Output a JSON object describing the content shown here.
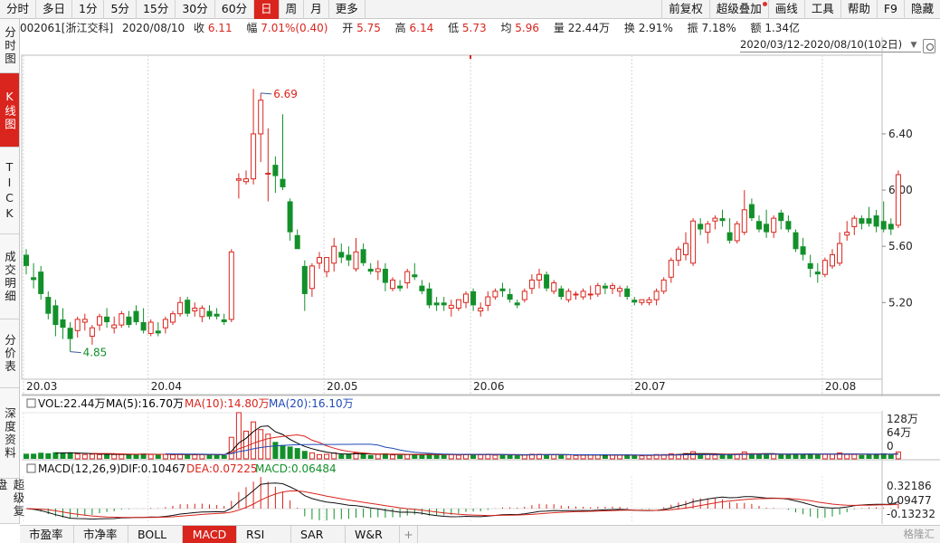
{
  "toolbar": {
    "periods": [
      "分时",
      "多日",
      "1分",
      "5分",
      "15分",
      "30分",
      "60分",
      "日",
      "周",
      "月",
      "更多"
    ],
    "active_period": "日",
    "right_buttons": [
      "前复权",
      "超级叠加",
      "画线",
      "工具",
      "帮助",
      "F9",
      "隐藏"
    ]
  },
  "info": {
    "code_name": "002061[浙江交科]",
    "date": "2020/08/10",
    "close_label": "收",
    "close": "6.11",
    "change_label": "幅",
    "change": "7.01%(0.40)",
    "open_label": "开",
    "open": "5.75",
    "high_label": "高",
    "high": "6.14",
    "low_label": "低",
    "low": "5.73",
    "avg_label": "均",
    "avg": "5.96",
    "volume_label": "量",
    "volume": "22.44万",
    "turnover_label": "换",
    "turnover": "2.91%",
    "amplitude_label": "振",
    "amplitude": "7.18%",
    "amount_label": "额",
    "amount": "1.34亿"
  },
  "side_tabs": [
    "分时图",
    "K线图",
    "TICK",
    "成交明细",
    "分价表",
    "深度资料",
    "超级复盘"
  ],
  "date_range": "2020/03/12-2020/08/10(102日)",
  "colors": {
    "up": "#d9251d",
    "down": "#12902a",
    "accent": "#d9251d",
    "ma5": "#000000",
    "ma10": "#d9251d",
    "ma20": "#1f49b8"
  },
  "chart_data": {
    "type": "candlestick",
    "price_axis": {
      "ticks": [
        "6.40",
        "6.00",
        "5.60",
        "5.20"
      ],
      "ylim": [
        4.68,
        6.96
      ]
    },
    "date_ticks": [
      {
        "label": "20.03",
        "index": 0
      },
      {
        "label": "20.04",
        "index": 17
      },
      {
        "label": "20.05",
        "index": 41
      },
      {
        "label": "20.06",
        "index": 61
      },
      {
        "label": "20.07",
        "index": 83
      },
      {
        "label": "20.08",
        "index": 109
      }
    ],
    "annotations": [
      {
        "label": "6.69",
        "index": 32
      },
      {
        "label": "4.85",
        "index": 6
      }
    ],
    "ohlc": [
      [
        5.54,
        5.58,
        5.4,
        5.46
      ],
      [
        5.38,
        5.48,
        5.3,
        5.36
      ],
      [
        5.42,
        5.46,
        5.22,
        5.26
      ],
      [
        5.24,
        5.28,
        5.08,
        5.12
      ],
      [
        5.18,
        5.22,
        4.96,
        5.04
      ],
      [
        5.08,
        5.16,
        4.94,
        5.02
      ],
      [
        5.02,
        5.06,
        4.85,
        4.94
      ],
      [
        5.0,
        5.1,
        4.95,
        5.08
      ],
      [
        5.06,
        5.12,
        5.0,
        5.08
      ],
      [
        4.96,
        5.04,
        4.9,
        5.02
      ],
      [
        5.04,
        5.12,
        5.0,
        5.1
      ],
      [
        5.1,
        5.16,
        5.02,
        5.06
      ],
      [
        5.02,
        5.1,
        4.98,
        5.04
      ],
      [
        5.04,
        5.14,
        5.02,
        5.12
      ],
      [
        5.1,
        5.14,
        5.02,
        5.04
      ],
      [
        5.14,
        5.18,
        5.04,
        5.06
      ],
      [
        5.06,
        5.16,
        4.98,
        5.0
      ],
      [
        4.98,
        5.08,
        4.96,
        5.06
      ],
      [
        5.0,
        5.06,
        4.96,
        4.98
      ],
      [
        5.02,
        5.1,
        4.98,
        5.08
      ],
      [
        5.06,
        5.14,
        5.04,
        5.12
      ],
      [
        5.12,
        5.24,
        5.1,
        5.2
      ],
      [
        5.22,
        5.24,
        5.1,
        5.12
      ],
      [
        5.14,
        5.2,
        5.1,
        5.16
      ],
      [
        5.1,
        5.18,
        5.06,
        5.16
      ],
      [
        5.14,
        5.18,
        5.08,
        5.1
      ],
      [
        5.12,
        5.16,
        5.08,
        5.1
      ],
      [
        5.08,
        5.12,
        5.04,
        5.06
      ],
      [
        5.08,
        5.58,
        5.06,
        5.56
      ],
      [
        6.07,
        6.12,
        5.94,
        6.08
      ],
      [
        6.06,
        6.14,
        6.04,
        6.08
      ],
      [
        6.08,
        6.72,
        6.04,
        6.4
      ],
      [
        6.4,
        6.69,
        6.2,
        6.64
      ],
      [
        6.12,
        6.44,
        5.92,
        6.12
      ],
      [
        6.18,
        6.24,
        5.98,
        6.1
      ],
      [
        6.08,
        6.54,
        6.0,
        6.02
      ],
      [
        5.92,
        5.94,
        5.64,
        5.7
      ],
      [
        5.68,
        5.72,
        5.58,
        5.58
      ],
      [
        5.46,
        5.5,
        5.14,
        5.26
      ],
      [
        5.3,
        5.48,
        5.24,
        5.46
      ],
      [
        5.48,
        5.56,
        5.44,
        5.52
      ],
      [
        5.42,
        5.52,
        5.38,
        5.52
      ],
      [
        5.48,
        5.66,
        5.42,
        5.6
      ],
      [
        5.56,
        5.62,
        5.48,
        5.52
      ],
      [
        5.54,
        5.6,
        5.46,
        5.5
      ],
      [
        5.44,
        5.66,
        5.42,
        5.56
      ],
      [
        5.58,
        5.62,
        5.46,
        5.48
      ],
      [
        5.44,
        5.48,
        5.4,
        5.42
      ],
      [
        5.42,
        5.5,
        5.36,
        5.44
      ],
      [
        5.44,
        5.48,
        5.28,
        5.34
      ],
      [
        5.3,
        5.38,
        5.28,
        5.36
      ],
      [
        5.32,
        5.36,
        5.28,
        5.3
      ],
      [
        5.34,
        5.44,
        5.3,
        5.42
      ],
      [
        5.4,
        5.48,
        5.36,
        5.38
      ],
      [
        5.32,
        5.36,
        5.26,
        5.28
      ],
      [
        5.3,
        5.34,
        5.16,
        5.18
      ],
      [
        5.2,
        5.24,
        5.14,
        5.18
      ],
      [
        5.2,
        5.24,
        5.14,
        5.18
      ],
      [
        5.16,
        5.22,
        5.1,
        5.18
      ],
      [
        5.16,
        5.22,
        5.14,
        5.22
      ],
      [
        5.2,
        5.28,
        5.16,
        5.26
      ],
      [
        5.28,
        5.3,
        5.14,
        5.18
      ],
      [
        5.14,
        5.2,
        5.1,
        5.16
      ],
      [
        5.18,
        5.28,
        5.14,
        5.24
      ],
      [
        5.24,
        5.3,
        5.22,
        5.28
      ],
      [
        5.3,
        5.34,
        5.24,
        5.28
      ],
      [
        5.26,
        5.3,
        5.2,
        5.22
      ],
      [
        5.2,
        5.22,
        5.16,
        5.18
      ],
      [
        5.22,
        5.3,
        5.2,
        5.28
      ],
      [
        5.3,
        5.4,
        5.26,
        5.36
      ],
      [
        5.36,
        5.44,
        5.3,
        5.4
      ],
      [
        5.4,
        5.42,
        5.28,
        5.3
      ],
      [
        5.28,
        5.36,
        5.26,
        5.34
      ],
      [
        5.3,
        5.32,
        5.22,
        5.24
      ],
      [
        5.22,
        5.3,
        5.2,
        5.28
      ],
      [
        5.26,
        5.28,
        5.22,
        5.26
      ],
      [
        5.24,
        5.3,
        5.22,
        5.28
      ],
      [
        5.26,
        5.32,
        5.22,
        5.26
      ],
      [
        5.26,
        5.34,
        5.24,
        5.32
      ],
      [
        5.32,
        5.34,
        5.26,
        5.3
      ],
      [
        5.3,
        5.34,
        5.26,
        5.32
      ],
      [
        5.28,
        5.32,
        5.24,
        5.3
      ],
      [
        5.3,
        5.32,
        5.22,
        5.24
      ],
      [
        5.22,
        5.24,
        5.18,
        5.2
      ],
      [
        5.2,
        5.22,
        5.18,
        5.22
      ],
      [
        5.2,
        5.24,
        5.18,
        5.22
      ],
      [
        5.22,
        5.3,
        5.18,
        5.28
      ],
      [
        5.28,
        5.38,
        5.26,
        5.36
      ],
      [
        5.38,
        5.52,
        5.34,
        5.5
      ],
      [
        5.5,
        5.6,
        5.46,
        5.58
      ],
      [
        5.54,
        5.7,
        5.5,
        5.62
      ],
      [
        5.48,
        5.8,
        5.46,
        5.78
      ],
      [
        5.76,
        5.8,
        5.68,
        5.72
      ],
      [
        5.7,
        5.78,
        5.62,
        5.76
      ],
      [
        5.78,
        5.82,
        5.72,
        5.8
      ],
      [
        5.8,
        5.86,
        5.74,
        5.78
      ],
      [
        5.7,
        5.8,
        5.62,
        5.64
      ],
      [
        5.64,
        5.78,
        5.62,
        5.76
      ],
      [
        5.7,
        6.0,
        5.68,
        5.86
      ],
      [
        5.9,
        5.94,
        5.78,
        5.8
      ],
      [
        5.78,
        5.82,
        5.7,
        5.72
      ],
      [
        5.76,
        5.86,
        5.66,
        5.7
      ],
      [
        5.7,
        5.82,
        5.66,
        5.8
      ],
      [
        5.84,
        5.86,
        5.72,
        5.78
      ],
      [
        5.78,
        5.82,
        5.7,
        5.72
      ],
      [
        5.7,
        5.72,
        5.56,
        5.58
      ],
      [
        5.6,
        5.66,
        5.5,
        5.54
      ],
      [
        5.48,
        5.54,
        5.38,
        5.44
      ],
      [
        5.42,
        5.48,
        5.34,
        5.4
      ],
      [
        5.4,
        5.52,
        5.38,
        5.5
      ],
      [
        5.46,
        5.58,
        5.44,
        5.54
      ],
      [
        5.48,
        5.7,
        5.46,
        5.62
      ],
      [
        5.68,
        5.78,
        5.64,
        5.7
      ],
      [
        5.74,
        5.82,
        5.68,
        5.8
      ],
      [
        5.8,
        5.82,
        5.72,
        5.76
      ],
      [
        5.8,
        5.88,
        5.74,
        5.76
      ],
      [
        5.82,
        5.86,
        5.7,
        5.74
      ],
      [
        5.78,
        5.92,
        5.7,
        5.72
      ],
      [
        5.76,
        5.8,
        5.68,
        5.72
      ],
      [
        5.75,
        6.14,
        5.73,
        6.11
      ]
    ],
    "volume_panel": {
      "label": "VOL:22.44万",
      "ma5": "MA(5):16.70万",
      "ma10": "MA(10):14.80万",
      "ma20": "MA(20):16.10万",
      "ticks": [
        "128万",
        "64万",
        "0"
      ],
      "ymax_wan": 150
    },
    "macd_panel": {
      "label": "MACD(12,26,9)",
      "dif": "DIF:0.10467",
      "dea": "DEA:0.07225",
      "macd": "MACD:0.06484",
      "ticks": [
        "0.32186",
        "0.09477",
        "-0.13232"
      ],
      "ylim": [
        -0.16,
        0.36
      ]
    }
  },
  "bottom_tabs": [
    "市盈率",
    "市净率",
    "BOLL",
    "MACD",
    "RSI",
    "SAR",
    "W&R"
  ],
  "active_bottom_tab": "MACD",
  "add_tab": "+",
  "watermark": "格隆汇"
}
